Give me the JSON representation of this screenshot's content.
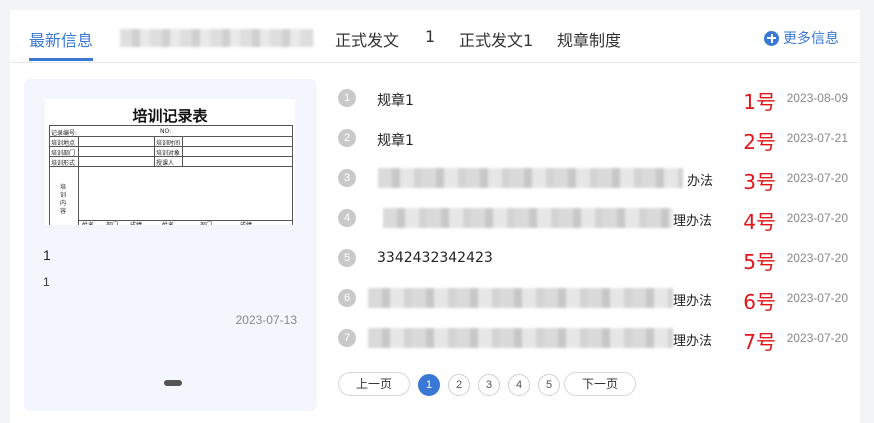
{
  "tabs": {
    "active": "最新信息",
    "items": [
      "正式发文",
      "1",
      "正式发文1",
      "规章制度"
    ],
    "more": "更多信息"
  },
  "card": {
    "thumbnail_title": "培训记录表",
    "table": {
      "r1a": "记录编号:",
      "r1b": "NO:",
      "r2a": "培训地点",
      "r2b": "培训时间",
      "r3a": "培训部门",
      "r3b": "培训对象",
      "r4a": "培训形式",
      "r4b": "授课人",
      "side": "培训内容",
      "footer": [
        "姓名",
        "部门",
        "成绩",
        "姓名",
        "部门",
        "成绩"
      ]
    },
    "title": "1",
    "desc": "1",
    "date": "2023-07-13"
  },
  "list": [
    {
      "num": "1",
      "title": "规章1",
      "tail": "",
      "hao": "1号",
      "date": "2023-08-09"
    },
    {
      "num": "2",
      "title": "规章1",
      "tail": "",
      "hao": "2号",
      "date": "2023-07-21"
    },
    {
      "num": "3",
      "title": "",
      "tail": "办法",
      "hao": "3号",
      "date": "2023-07-20"
    },
    {
      "num": "4",
      "title": "",
      "tail": "理办法",
      "hao": "4号",
      "date": "2023-07-20"
    },
    {
      "num": "5",
      "title": "3342432342423",
      "tail": "",
      "hao": "5号",
      "date": "2023-07-20"
    },
    {
      "num": "6",
      "title": "",
      "tail": "理办法",
      "hao": "6号",
      "date": "2023-07-20"
    },
    {
      "num": "7",
      "title": "",
      "tail": "理办法",
      "hao": "7号",
      "date": "2023-07-20"
    }
  ],
  "pagination": {
    "prev": "上一页",
    "next": "下一页",
    "pages": [
      "1",
      "2",
      "3",
      "4",
      "5"
    ],
    "current": "1"
  },
  "colors": {
    "accent": "#3a78d6",
    "highlight": "#e4141b"
  }
}
